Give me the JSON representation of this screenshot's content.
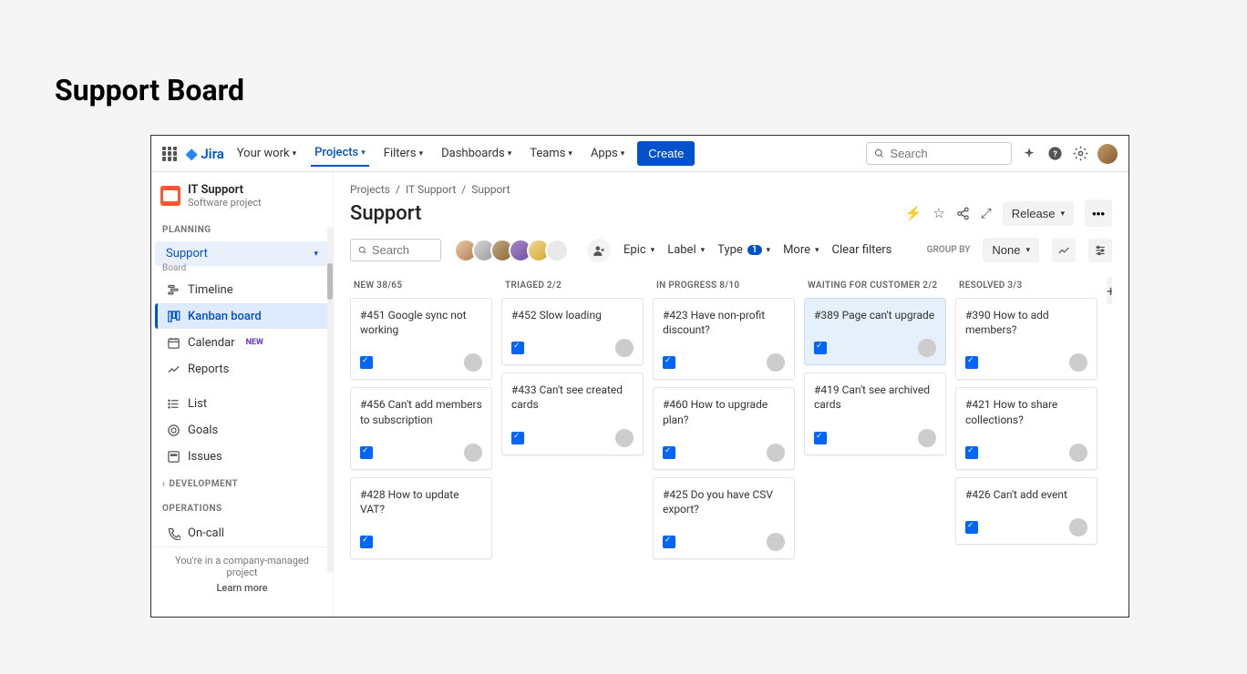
{
  "outer_title": "Support Board",
  "topnav": {
    "product": "Jira",
    "items": [
      {
        "label": "Your work",
        "active": false
      },
      {
        "label": "Projects",
        "active": true
      },
      {
        "label": "Filters",
        "active": false
      },
      {
        "label": "Dashboards",
        "active": false
      },
      {
        "label": "Teams",
        "active": false
      },
      {
        "label": "Apps",
        "active": false
      }
    ],
    "create": "Create",
    "search_placeholder": "Search"
  },
  "sidebar": {
    "project_name": "IT Support",
    "project_type": "Software project",
    "sections": {
      "planning": "PLANNING",
      "development": "DEVELOPMENT",
      "operations": "OPERATIONS"
    },
    "support_board": {
      "label": "Support",
      "sub": "Board"
    },
    "items": [
      {
        "label": "Timeline"
      },
      {
        "label": "Kanban board"
      },
      {
        "label": "Calendar",
        "badge": "NEW"
      },
      {
        "label": "Reports"
      },
      {
        "label": "List"
      },
      {
        "label": "Goals"
      },
      {
        "label": "Issues"
      }
    ],
    "oncall": "On-call",
    "footer": "You're in a company-managed project",
    "learn_more": "Learn more"
  },
  "breadcrumbs": [
    "Projects",
    "IT Support",
    "Support"
  ],
  "page_title": "Support",
  "head_actions": {
    "release": "Release"
  },
  "toolbar": {
    "search_placeholder": "Search",
    "filters": {
      "epic": "Epic",
      "label": "Label",
      "type": "Type",
      "type_count": "1",
      "more": "More",
      "clear": "Clear filters"
    },
    "group_by_label": "GROUP BY",
    "group_by_value": "None"
  },
  "columns": [
    {
      "header": "NEW 38/65",
      "cards": [
        {
          "title": "#451 Google sync not working",
          "avatar": "sa3"
        },
        {
          "title": "#456 Can't add members to subscription",
          "avatar": "sa5"
        },
        {
          "title": "#428 How to update VAT?",
          "avatar": ""
        }
      ]
    },
    {
      "header": "TRIAGED 2/2",
      "cards": [
        {
          "title": "#452 Slow loading",
          "avatar": "sa1"
        },
        {
          "title": "#433 Can't see created cards",
          "avatar": "sa1"
        }
      ]
    },
    {
      "header": "IN PROGRESS 8/10",
      "cards": [
        {
          "title": "#423 Have non-profit discount?",
          "avatar": "sa3"
        },
        {
          "title": "#460 How to upgrade plan?",
          "avatar": "sa1"
        },
        {
          "title": "#425 Do you have CSV export?",
          "avatar": "sa3"
        }
      ]
    },
    {
      "header": "WAITING FOR CUSTOMER 2/2",
      "cards": [
        {
          "title": "#389 Page can't upgrade",
          "avatar": "sa3",
          "hl": true
        },
        {
          "title": "#419 Can't see archived cards",
          "avatar": "sa5"
        }
      ]
    },
    {
      "header": "RESOLVED 3/3",
      "cards": [
        {
          "title": "#390 How to add members?",
          "avatar": "sa3"
        },
        {
          "title": "#421 How to share collections?",
          "avatar": "sa5"
        },
        {
          "title": "#426 Can't add event",
          "avatar": "sa5"
        }
      ]
    }
  ]
}
